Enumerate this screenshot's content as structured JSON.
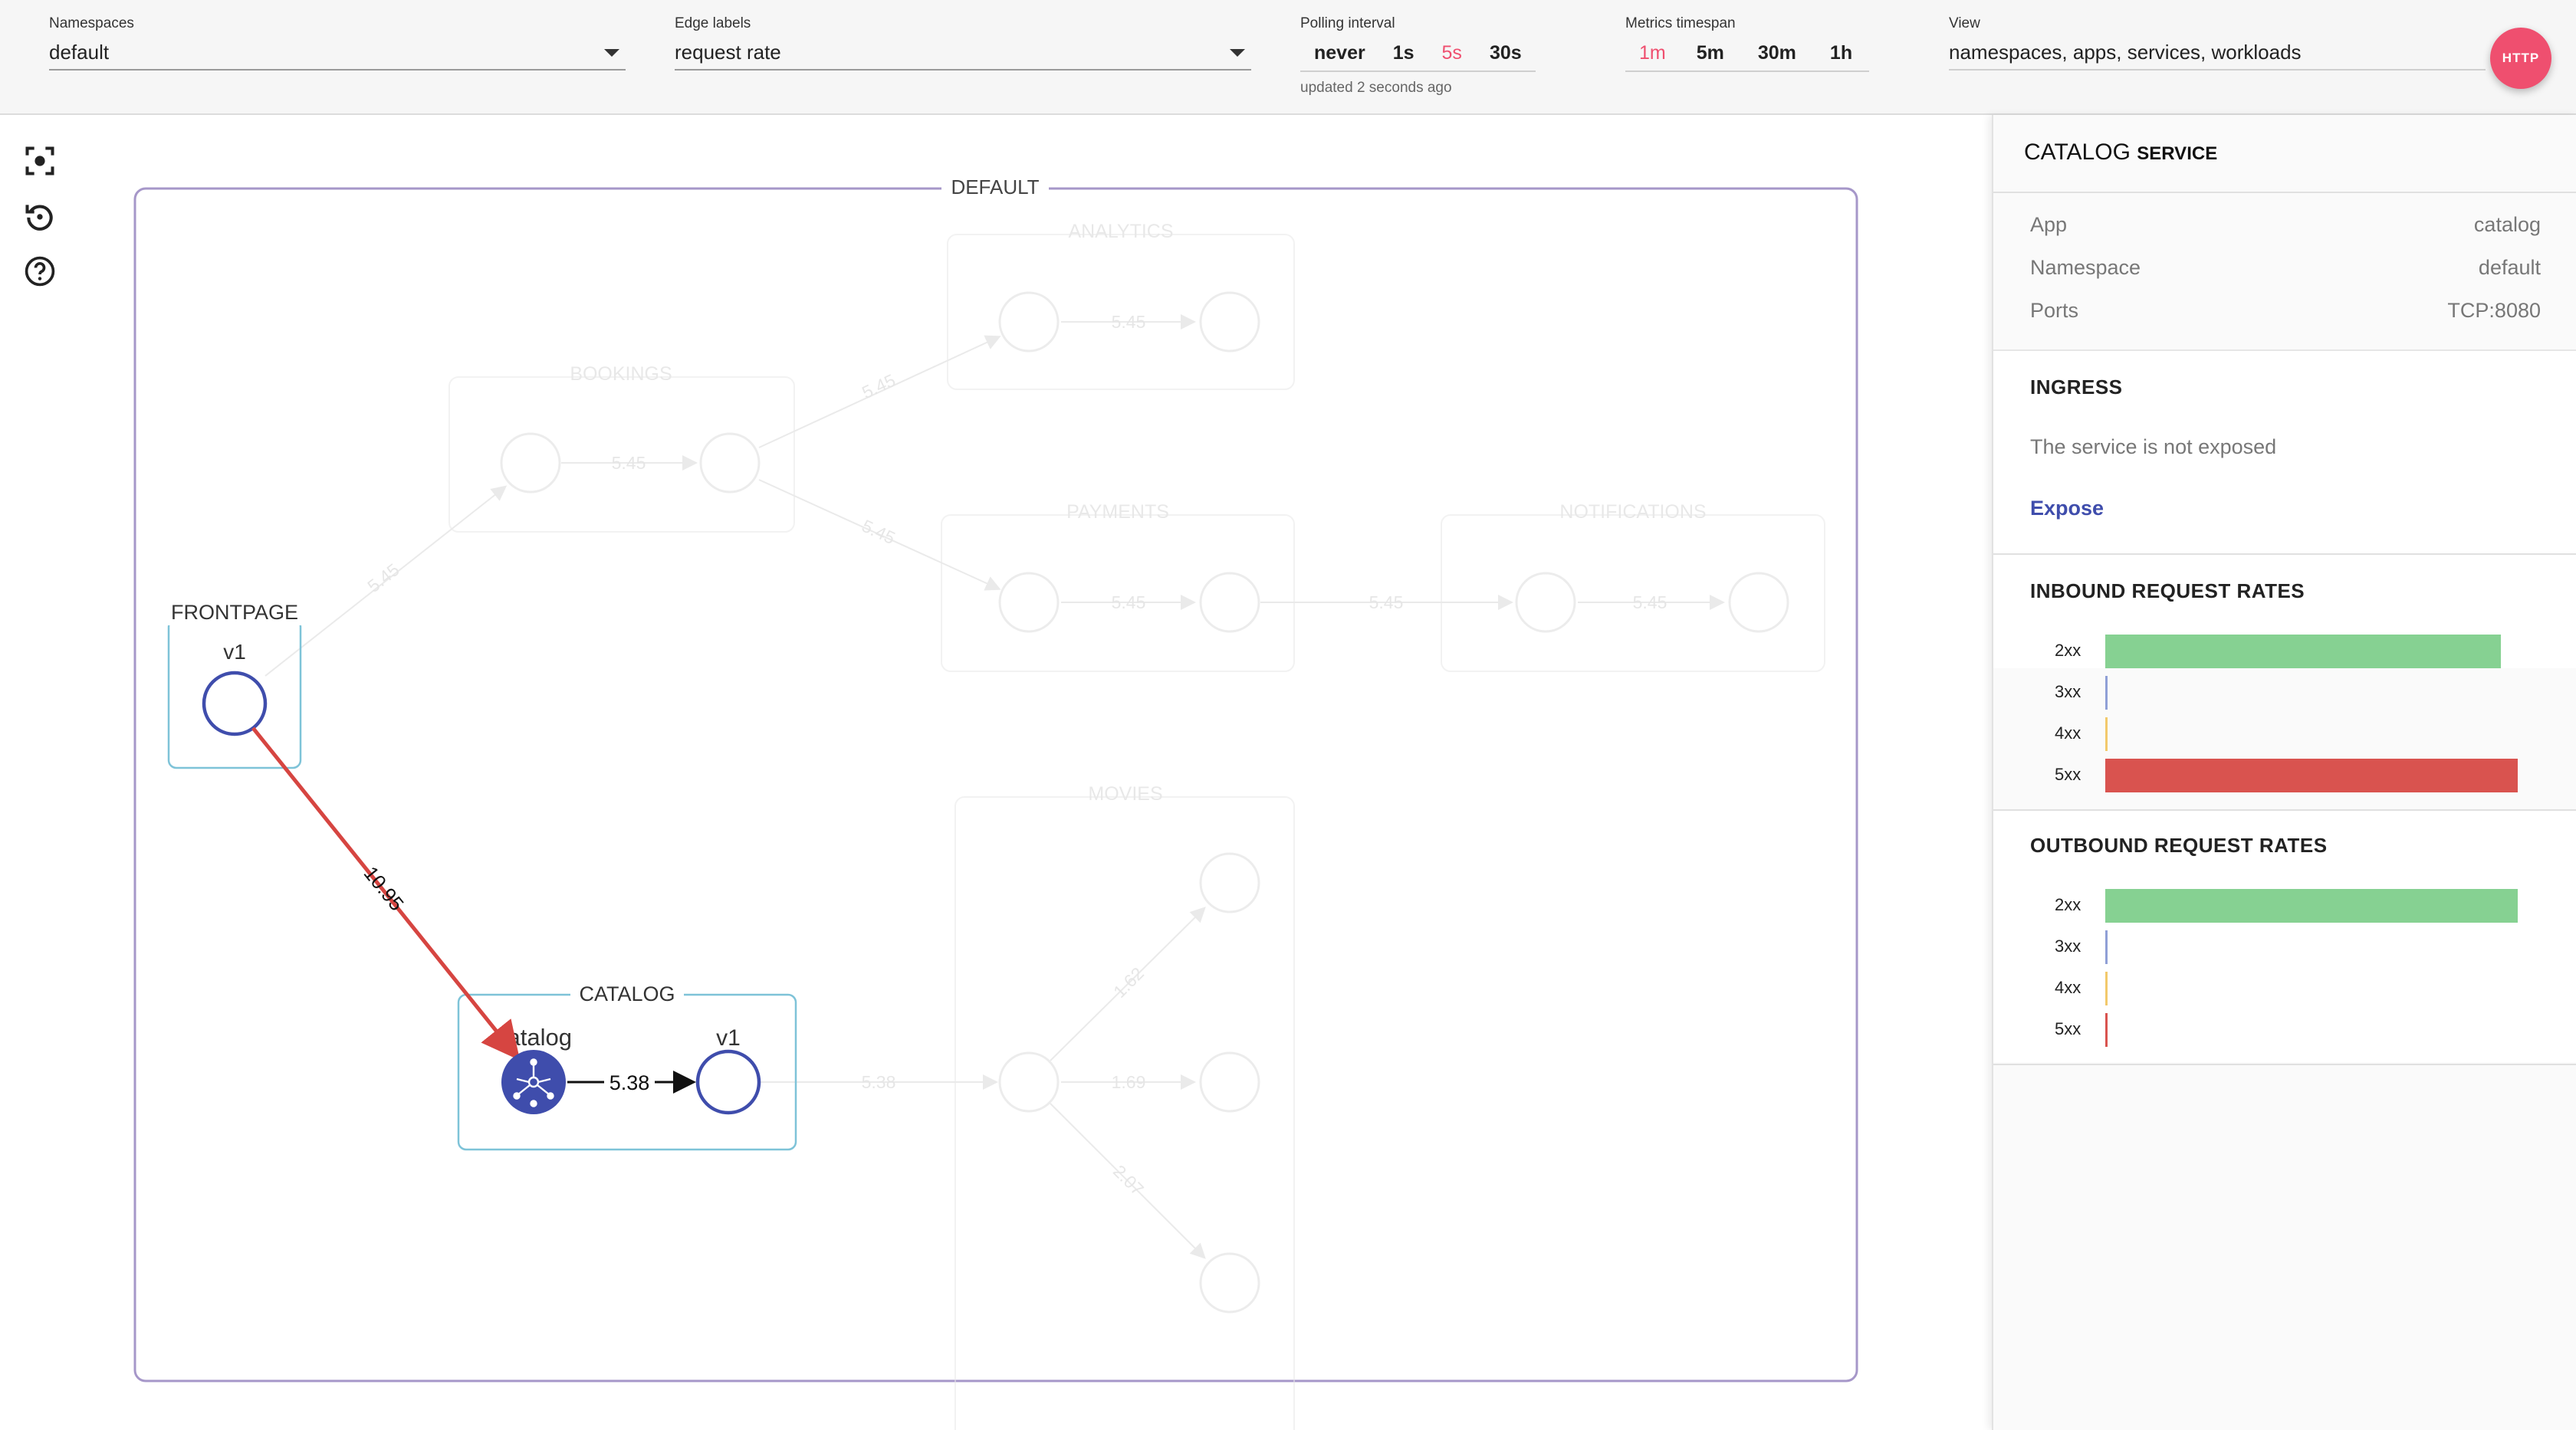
{
  "toolbar": {
    "namespaces": {
      "label": "Namespaces",
      "value": "default"
    },
    "edge_labels": {
      "label": "Edge labels",
      "value": "request rate"
    },
    "polling": {
      "label": "Polling interval",
      "options": [
        "never",
        "1s",
        "5s",
        "30s"
      ],
      "active": "5s",
      "updated": "updated 2 seconds ago"
    },
    "timespan": {
      "label": "Metrics timespan",
      "options": [
        "1m",
        "5m",
        "30m",
        "1h"
      ],
      "active": "1m"
    },
    "view": {
      "label": "View",
      "value": "namespaces, apps, services, workloads"
    },
    "http_button": "HTTP"
  },
  "tools": [
    {
      "name": "center-graph-icon"
    },
    {
      "name": "reset-layout-icon"
    },
    {
      "name": "help-icon"
    }
  ],
  "graph": {
    "namespace_label": "DEFAULT",
    "apps": {
      "frontpage": "FRONTPAGE",
      "catalog": "CATALOG",
      "bookings": "BOOKINGS",
      "analytics": "ANALYTICS",
      "payments": "PAYMENTS",
      "notifications": "NOTIFICATIONS",
      "movies": "MOVIES"
    },
    "nodes": {
      "frontpage_v1": "v1",
      "catalog_service": "catalog",
      "catalog_v1": "v1"
    },
    "edges": {
      "frontpage_to_catalog": "10.95",
      "catalog_service_to_v1": "5.38",
      "frontpage_to_bookings": "5.45",
      "bookings_internal": "5.45",
      "bookings_to_analytics": "5.45",
      "bookings_to_payments": "5.45",
      "analytics_internal": "5.45",
      "payments_internal": "5.45",
      "payments_to_notifications": "5.45",
      "notifications_internal": "5.45",
      "catalog_to_movies": "5.38",
      "movies_up": "1.62",
      "movies_mid": "1.69",
      "movies_down": "2.07"
    },
    "colors": {
      "error_edge": "#d64541",
      "node_border": "#3f4dac",
      "namespace_border": "#a697c9",
      "app_border": "#7ec3d8"
    }
  },
  "panel": {
    "title_main": "CATALOG",
    "title_small": "SERVICE",
    "info": [
      {
        "key": "App",
        "value": "catalog"
      },
      {
        "key": "Namespace",
        "value": "default"
      },
      {
        "key": "Ports",
        "value": "TCP:8080"
      }
    ],
    "ingress": {
      "title": "INGRESS",
      "text": "The service is not exposed",
      "link": "Expose"
    },
    "inbound": {
      "title": "INBOUND REQUEST RATES",
      "rates": [
        {
          "label": "2xx",
          "fraction": 0.96,
          "color": "#86d192"
        },
        {
          "label": "3xx",
          "fraction": 0.0,
          "color": "#8f9fd6"
        },
        {
          "label": "4xx",
          "fraction": 0.0,
          "color": "#f2c96b"
        },
        {
          "label": "5xx",
          "fraction": 1.0,
          "color": "#d9534f"
        }
      ]
    },
    "outbound": {
      "title": "OUTBOUND REQUEST RATES",
      "rates": [
        {
          "label": "2xx",
          "fraction": 1.0,
          "color": "#86d192"
        },
        {
          "label": "3xx",
          "fraction": 0.0,
          "color": "#8f9fd6"
        },
        {
          "label": "4xx",
          "fraction": 0.0,
          "color": "#f2c96b"
        },
        {
          "label": "5xx",
          "fraction": 0.0,
          "color": "#d9534f"
        }
      ]
    }
  }
}
